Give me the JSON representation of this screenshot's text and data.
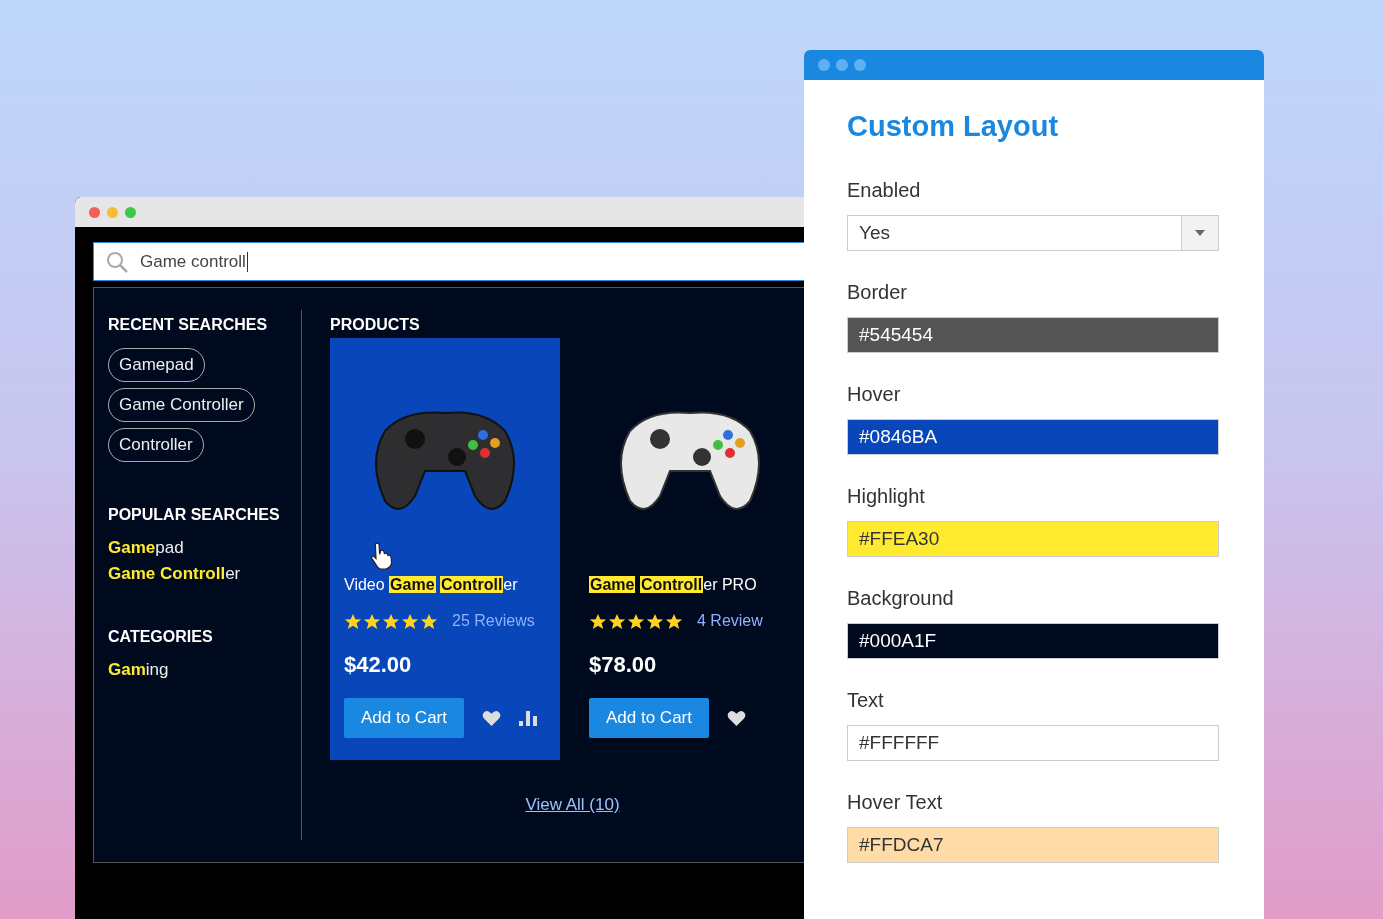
{
  "browser": {
    "search": {
      "value": "Game controll"
    },
    "recent_searches": {
      "title": "RECENT SEARCHES",
      "items": [
        "Gamepad",
        "Game Controller",
        "Controller"
      ]
    },
    "popular_searches": {
      "title": "POPULAR SEARCHES",
      "items": [
        "**Game**pad",
        "**Game Controll**er"
      ]
    },
    "categories": {
      "title": "CATEGORIES",
      "items": [
        "**Gam**ing"
      ]
    },
    "products": {
      "title": "PRODUCTS",
      "items": [
        {
          "name": "Video **Game** **Controll**er",
          "kind": "dark",
          "hovered": true,
          "stars": 5,
          "reviews": "25 Reviews",
          "price": "$42.00",
          "button": "Add to Cart",
          "compare": true
        },
        {
          "name": "**Game** **Controll**er PRO",
          "kind": "light",
          "hovered": false,
          "stars": 5,
          "reviews": "4 Review",
          "price": "$78.00",
          "button": "Add to Cart",
          "compare": false
        }
      ],
      "view_all": "View All (10)"
    }
  },
  "settings": {
    "title": "Custom Layout",
    "fields": [
      {
        "kind": "select",
        "label": "Enabled",
        "value": "Yes"
      },
      {
        "kind": "color",
        "label": "Border",
        "value": "#545454",
        "color": "#545454"
      },
      {
        "kind": "color",
        "label": "Hover",
        "value": "#0846BA",
        "color": "#0846ba"
      },
      {
        "kind": "color",
        "label": "Highlight",
        "value": "#FFEA30",
        "color": "#ffea30"
      },
      {
        "kind": "color",
        "label": "Background",
        "value": "#000A1F",
        "color": "#000a1f"
      },
      {
        "kind": "color",
        "label": "Text",
        "value": "#FFFFFF",
        "color": "#ffffff"
      },
      {
        "kind": "color",
        "label": "Hover Text",
        "value": "#FFDCA7",
        "color": "#ffdca7"
      }
    ]
  }
}
